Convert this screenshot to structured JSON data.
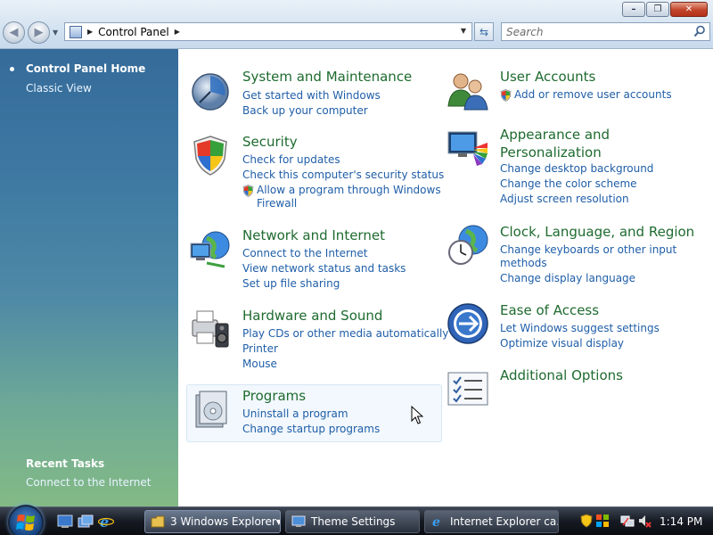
{
  "window": {
    "minimize_symbol": "–",
    "restore_symbol": "❐",
    "close_symbol": "✕"
  },
  "nav": {
    "back_symbol": "◀",
    "forward_symbol": "▶",
    "dropdown_symbol": "▼",
    "refresh_symbol": "⇆"
  },
  "address": {
    "crumb_arrow": "▶",
    "path": "Control Panel",
    "trailing_arrow": "▶",
    "dropdown_symbol": "▼"
  },
  "search": {
    "placeholder": "Search"
  },
  "sidebar": {
    "home": "Control Panel Home",
    "classic": "Classic View",
    "recent_heading": "Recent Tasks",
    "recent_items": [
      "Connect to the Internet"
    ]
  },
  "categories": {
    "system": {
      "title": "System and Maintenance",
      "links": [
        "Get started with Windows",
        "Back up your computer"
      ]
    },
    "security": {
      "title": "Security",
      "links": [
        "Check for updates",
        "Check this computer's security status",
        "Allow a program through Windows",
        "Firewall"
      ]
    },
    "network": {
      "title": "Network and Internet",
      "links": [
        "Connect to the Internet",
        "View network status and tasks",
        "Set up file sharing"
      ]
    },
    "hardware": {
      "title": "Hardware and Sound",
      "links": [
        "Play CDs or other media automatically",
        "Printer",
        "Mouse"
      ]
    },
    "programs": {
      "title": "Programs",
      "links": [
        "Uninstall a program",
        "Change startup programs"
      ]
    },
    "accounts": {
      "title": "User Accounts",
      "links": [
        "Add or remove user accounts"
      ]
    },
    "appearance": {
      "title_line1": "Appearance and",
      "title_line2": "Personalization",
      "links": [
        "Change desktop background",
        "Change the color scheme",
        "Adjust screen resolution"
      ]
    },
    "clock": {
      "title": "Clock, Language, and Region",
      "links": [
        "Change keyboards or other input",
        "methods",
        "Change display language"
      ]
    },
    "ease": {
      "title": "Ease of Access",
      "links": [
        "Let Windows suggest settings",
        "Optimize visual display"
      ]
    },
    "additional": {
      "title": "Additional Options"
    }
  },
  "taskbar": {
    "tasks": [
      "3 Windows Explorer",
      "Theme Settings",
      "Internet Explorer ca..."
    ],
    "group_dropdown": "▼",
    "clock": "1:14 PM"
  }
}
